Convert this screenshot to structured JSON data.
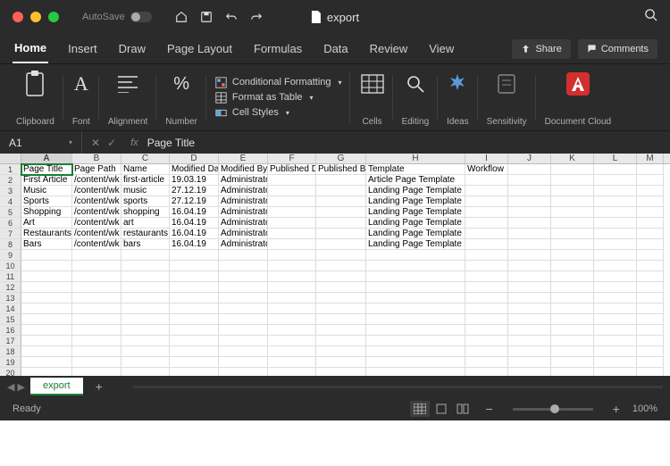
{
  "titlebar": {
    "autosave": "AutoSave",
    "filename": "export"
  },
  "tabs": [
    "Home",
    "Insert",
    "Draw",
    "Page Layout",
    "Formulas",
    "Data",
    "Review",
    "View"
  ],
  "activeTab": "Home",
  "share": "Share",
  "comments": "Comments",
  "ribbon": {
    "clipboard": "Clipboard",
    "font": "Font",
    "alignment": "Alignment",
    "number": "Number",
    "condFormat": "Conditional Formatting",
    "formatTable": "Format as Table",
    "cellStyles": "Cell Styles",
    "cells": "Cells",
    "editing": "Editing",
    "ideas": "Ideas",
    "sensitivity": "Sensitivity",
    "docCloud": "Document\nCloud"
  },
  "nameBox": "A1",
  "formula": "Page Title",
  "columns": [
    "A",
    "B",
    "C",
    "D",
    "E",
    "F",
    "G",
    "H",
    "I",
    "J",
    "K",
    "L",
    "M"
  ],
  "headers": [
    "Page Title",
    "Page Path",
    "Name",
    "Modified Date",
    "Modified By",
    "Published Date",
    "Published By",
    "Template",
    "Workflow"
  ],
  "data": [
    [
      "First Article",
      "/content/wk",
      "first-article",
      "19.03.19",
      "Administrator",
      "",
      "",
      "Article Page Template",
      ""
    ],
    [
      "Music",
      "/content/wk",
      "music",
      "27.12.19",
      "Administrator",
      "",
      "",
      "Landing Page Template",
      ""
    ],
    [
      "Sports",
      "/content/wk",
      "sports",
      "27.12.19",
      "Administrator",
      "",
      "",
      "Landing Page Template",
      ""
    ],
    [
      "Shopping",
      "/content/wk",
      "shopping",
      "16.04.19",
      "Administrator",
      "",
      "",
      "Landing Page Template",
      ""
    ],
    [
      "Art",
      "/content/wk",
      "art",
      "16.04.19",
      "Administrator",
      "",
      "",
      "Landing Page Template",
      ""
    ],
    [
      "Restaurants",
      "/content/wk",
      "restaurants",
      "16.04.19",
      "Administrator",
      "",
      "",
      "Landing Page Template",
      ""
    ],
    [
      "Bars",
      "/content/wk",
      "bars",
      "16.04.19",
      "Administrator",
      "",
      "",
      "Landing Page Template",
      ""
    ]
  ],
  "sheetName": "export",
  "status": "Ready",
  "zoom": "100%"
}
